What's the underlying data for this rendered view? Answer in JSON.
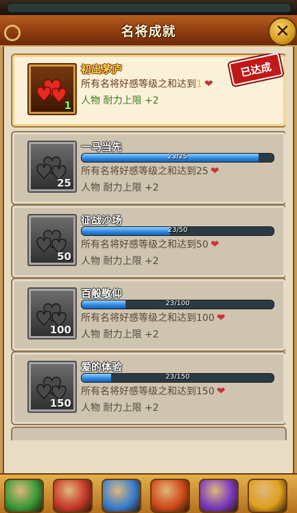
{
  "header": {
    "title": "名将成就"
  },
  "achievements": [
    {
      "name": "初出茅庐",
      "icon_num": "1",
      "cond": "所有名将好感等级之和达到",
      "cond_num": "1",
      "reward": "人物 耐力上限 +2",
      "progress_text": "",
      "progress": 1,
      "done": true,
      "stamp": "已达成"
    },
    {
      "name": "一马当先",
      "icon_num": "25",
      "cond": "所有名将好感等级之和达到",
      "cond_num": "25",
      "reward": "人物 耐力上限 +2",
      "progress_text": "23/25",
      "progress": 0.92,
      "done": false
    },
    {
      "name": "征战沙场",
      "icon_num": "50",
      "cond": "所有名将好感等级之和达到",
      "cond_num": "50",
      "reward": "人物 耐力上限 +2",
      "progress_text": "23/50",
      "progress": 0.46,
      "done": false
    },
    {
      "name": "百般敬仰",
      "icon_num": "100",
      "cond": "所有名将好感等级之和达到",
      "cond_num": "100",
      "reward": "人物 耐力上限 +2",
      "progress_text": "23/100",
      "progress": 0.23,
      "done": false
    },
    {
      "name": "爱的体验",
      "icon_num": "150",
      "cond": "所有名将好感等级之和达到",
      "cond_num": "150",
      "reward": "人物 耐力上限 +2",
      "progress_text": "23/150",
      "progress": 0.153,
      "done": false
    }
  ],
  "colors": {
    "accent": "#b55d1d",
    "progress": "#2a84e0",
    "done_stamp": "#c21818"
  },
  "bottom_nav": [
    {
      "icon": "palace-icon",
      "color": "#3a9a3a"
    },
    {
      "icon": "scroll-icon",
      "color": "#c83a2a"
    },
    {
      "icon": "sword-icon",
      "color": "#3a7fd0"
    },
    {
      "icon": "drum-icon",
      "color": "#d04a1a"
    },
    {
      "icon": "gems-icon",
      "color": "#7a3ac0"
    },
    {
      "icon": "treasure-chest-icon",
      "color": "#e0a020"
    }
  ]
}
